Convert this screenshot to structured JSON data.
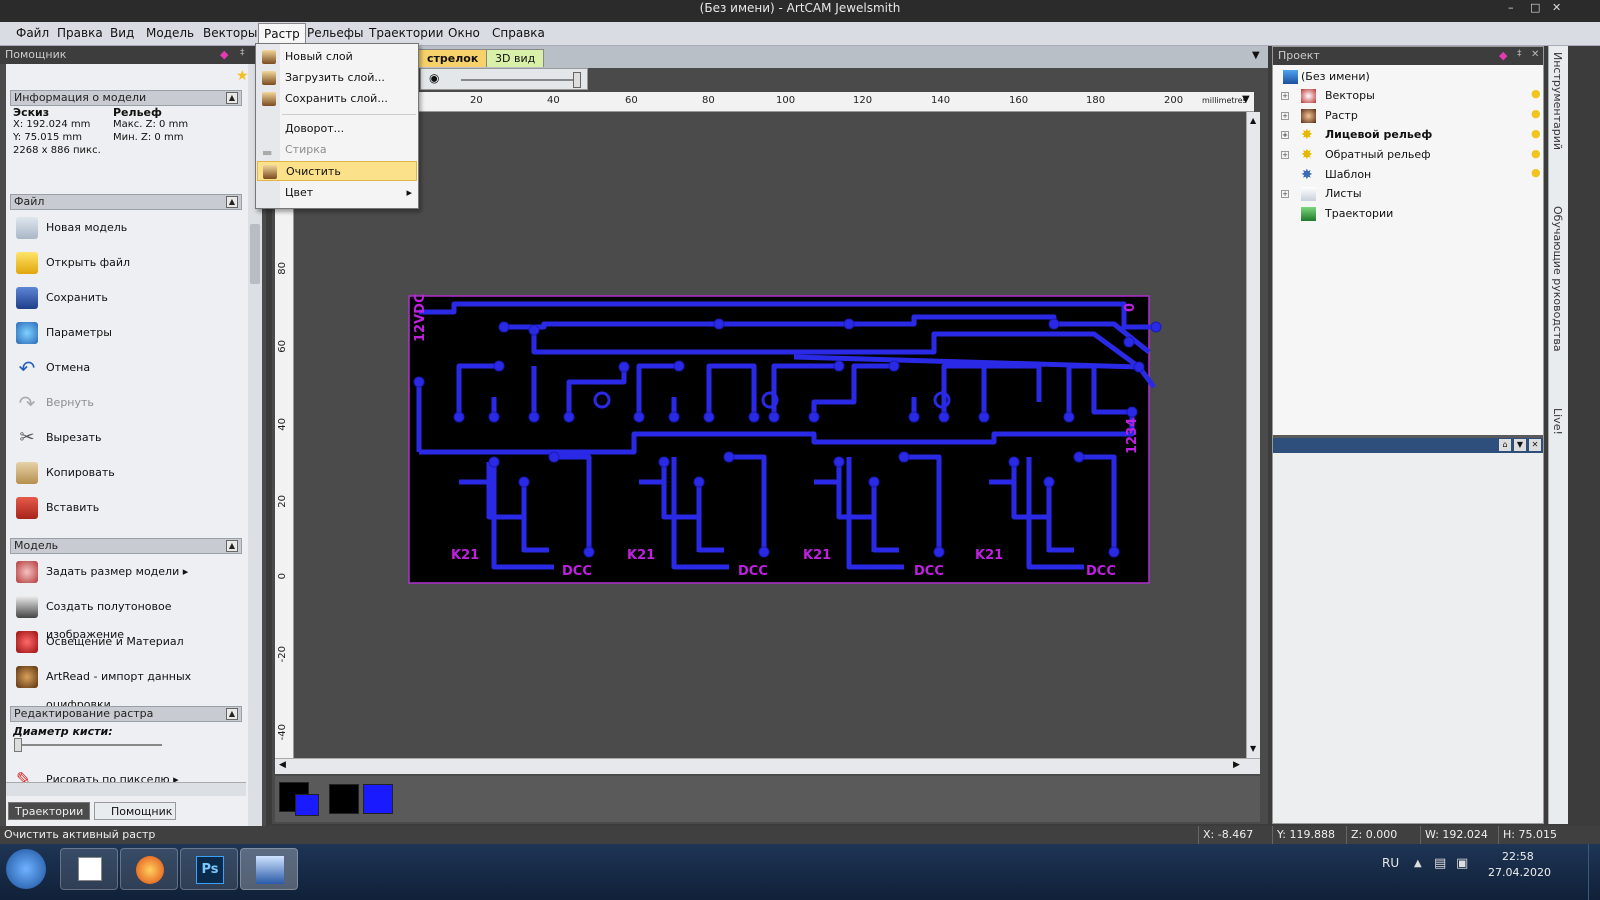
{
  "window": {
    "title": "(Без имени) - ArtCAM Jewelsmith"
  },
  "menubar": [
    "Файл",
    "Правка",
    "Вид",
    "Модель",
    "Векторы",
    "Растр",
    "Рельефы",
    "Траектории",
    "Окно",
    "Справка"
  ],
  "helper_panel": {
    "title": "Помощник",
    "model_info": {
      "header": "Информация о модели",
      "sketch_label": "Эскиз",
      "relief_label": "Рельеф",
      "x": "X: 192.024 mm",
      "y": "Y: 75.015 mm",
      "pixels": "2268 x 886 пикс.",
      "max_z": "Макс. Z: 0 mm",
      "min_z": "Мин. Z: 0 mm"
    },
    "file_section": {
      "header": "Файл",
      "items": [
        "Новая модель",
        "Открыть файл",
        "Сохранить",
        "Параметры",
        "Отмена",
        "Вернуть",
        "Вырезать",
        "Копировать",
        "Вставить"
      ]
    },
    "model_section": {
      "header": "Модель",
      "items": [
        "Задать размер модели",
        "Создать полутоновое изображение",
        "Освещение и Материал",
        "ArtRead - импорт данных оцифровки"
      ]
    },
    "raster_edit": {
      "header": "Редактирование растра",
      "brush_label": "Диаметр кисти:",
      "draw_label": "Рисовать по пикселю"
    },
    "bottom_tabs": [
      "Траектории",
      "Помощник"
    ]
  },
  "raster_menu": {
    "items": [
      "Новый слой",
      "Загрузить слой...",
      "Сохранить слой...",
      "Доворот...",
      "Стирка",
      "Очистить",
      "Цвет"
    ],
    "highlighted": "Очистить",
    "disabled": "Стирка"
  },
  "view": {
    "tab_2d": "стрелок",
    "tab_3d": "3D вид",
    "ruler_unit": "millimetres",
    "ruler_h": [
      "20",
      "40",
      "60",
      "80",
      "100",
      "120",
      "140",
      "160",
      "180",
      "200"
    ],
    "ruler_v": [
      "80",
      "60",
      "40",
      "20",
      "0",
      "-20",
      "-40"
    ]
  },
  "pcb": {
    "top_left_text": "12VDC",
    "top_right_text": "0",
    "right_text": "1234",
    "relay_labels": [
      "K21",
      "K21",
      "K21",
      "K21"
    ],
    "dcc_labels": [
      "DCC",
      "DCC",
      "DCC",
      "DCC"
    ]
  },
  "colors": {
    "primary": "#000000",
    "secondary": "#1a1aff",
    "swatches": [
      "#000000",
      "#1a1aff"
    ],
    "trace": "#2a2ae6",
    "pcb_text": "#c020e0",
    "menu_highlight": "#fbe18a"
  },
  "project_panel": {
    "title": "Проект",
    "root": "(Без имени)",
    "items": [
      "Векторы",
      "Растр",
      "Лицевой рельеф",
      "Обратный рельеф",
      "Шаблон",
      "Листы",
      "Траектории"
    ]
  },
  "side_tabs": [
    "Инструментарий",
    "Обучающие руководства",
    "Live!"
  ],
  "status": {
    "message": "Очистить активный растр",
    "x": "X: -8.467",
    "y": "Y: 119.888",
    "z": "Z: 0.000",
    "w": "W: 192.024",
    "h": "H: 75.015"
  },
  "taskbar": {
    "lang": "RU",
    "time": "22:58",
    "date": "27.04.2020",
    "apps": [
      "windows-start",
      "notepad",
      "firefox",
      "photoshop",
      "artcam"
    ],
    "ps_label": "Ps"
  }
}
